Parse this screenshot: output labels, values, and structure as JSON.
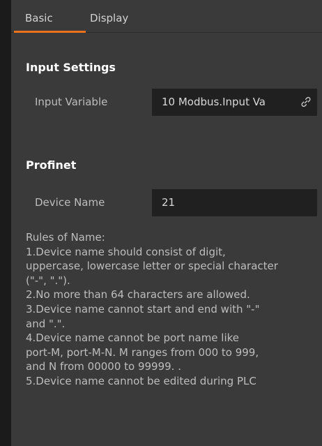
{
  "tabs": {
    "basic": "Basic",
    "display": "Display"
  },
  "input_settings": {
    "title": "Input Settings",
    "input_variable_label": "Input Variable",
    "input_variable_value": "10 Modbus.Input Va",
    "link_icon": "link-icon"
  },
  "profinet": {
    "title": "Profinet",
    "device_name_label": "Device Name",
    "device_name_value": "21",
    "rules": [
      "Rules of Name:",
      "1.Device name should consist of digit,",
      "uppercase, lowercase letter or special character",
      "(\"-\", \".\").",
      "2.No more than 64 characters are allowed.",
      "3.Device name cannot start and end with \"-\"",
      "and \".\".",
      "4.Device name cannot be port name like",
      "port-M, port-M-N. M ranges from 000 to 999,",
      "and N from 00000 to 99999. .",
      "5.Device name cannot be edited during PLC"
    ]
  },
  "colors": {
    "accent": "#e8731c",
    "panel_bg": "#3a3a3a",
    "field_bg": "#202020"
  }
}
